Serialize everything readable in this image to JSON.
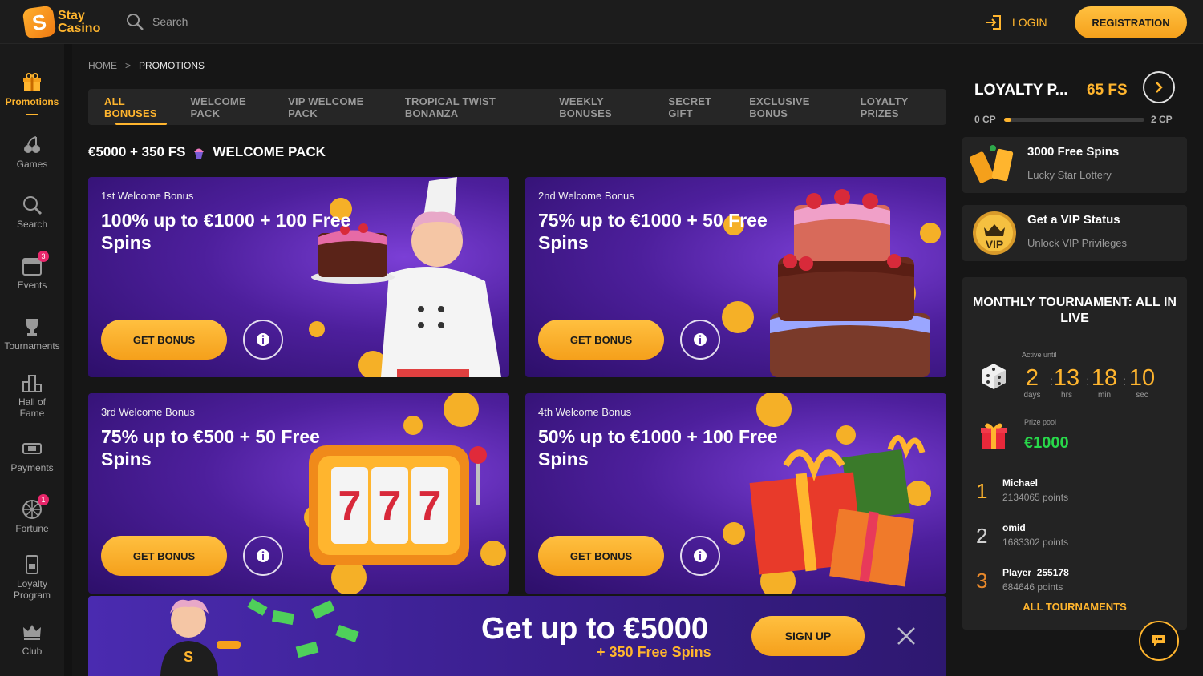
{
  "brand": {
    "name_line1": "Stay",
    "name_line2": "Casino",
    "accent": "#ffb52e"
  },
  "header": {
    "search_label": "Search",
    "login_label": "LOGIN",
    "registration_label": "REGISTRATION"
  },
  "sidebar": {
    "items": [
      {
        "label": "Promotions",
        "icon": "gift-icon",
        "active": true
      },
      {
        "label": "Games",
        "icon": "cherries-icon"
      },
      {
        "label": "Search",
        "icon": "search-icon"
      },
      {
        "label": "Events",
        "icon": "calendar-icon",
        "badge": "3"
      },
      {
        "label": "Tournaments",
        "icon": "trophy-icon"
      },
      {
        "label": "Hall of\nFame",
        "icon": "podium-icon"
      },
      {
        "label": "Payments",
        "icon": "card-icon"
      },
      {
        "label": "Fortune",
        "icon": "wheel-icon",
        "badge": "1"
      },
      {
        "label": "Loyalty\nProgram",
        "icon": "vip-card-icon"
      },
      {
        "label": "Club",
        "icon": "crown-icon"
      }
    ]
  },
  "breadcrumb": {
    "home": "HOME",
    "separator": ">",
    "current": "PROMOTIONS"
  },
  "tabs": [
    "ALL BONUSES",
    "WELCOME PACK",
    "VIP WELCOME PACK",
    "TROPICAL TWIST BONANZA",
    "WEEKLY BONUSES",
    "SECRET GIFT",
    "EXCLUSIVE BONUS",
    "LOYALTY PRIZES"
  ],
  "section": {
    "title_left": "€5000 + 350 FS",
    "title_right": "WELCOME PACK"
  },
  "cards": [
    {
      "kicker": "1st Welcome Bonus",
      "headline": "100% up to €1000 + 100 Free Spins",
      "button": "GET BONUS",
      "art": "chef-grandma-cake-art"
    },
    {
      "kicker": "2nd Welcome Bonus",
      "headline": "75% up to €1000 + 50 Free Spins",
      "button": "GET BONUS",
      "art": "layer-cake-art"
    },
    {
      "kicker": "3rd Welcome Bonus",
      "headline": "75% up to €500 + 50 Free Spins",
      "button": "GET BONUS",
      "art": "slot-machine-777-art"
    },
    {
      "kicker": "4th Welcome Bonus",
      "headline": "50% up to €1000 + 100 Free Spins",
      "button": "GET BONUS",
      "art": "gift-boxes-art"
    }
  ],
  "banner": {
    "headline": "Get up to €5000",
    "subline": "+ 350 Free Spins",
    "button": "SIGN UP"
  },
  "loyalty": {
    "title": "LOYALTY P...",
    "free_spins": "65 FS",
    "cp_min": "0 CP",
    "cp_max": "2 CP",
    "progress_fraction": 0.05
  },
  "promos": [
    {
      "title": "3000 Free Spins",
      "subtitle": "Lucky Star Lottery",
      "icon": "lottery-tickets-icon"
    },
    {
      "title": "Get a VIP Status",
      "subtitle": "Unlock VIP Privileges",
      "icon": "vip-crown-icon"
    }
  ],
  "tournament": {
    "title": "MONTHLY TOURNAMENT: ALL IN LIVE",
    "active_until_label": "Active until",
    "countdown": [
      {
        "value": "2",
        "unit": "days"
      },
      {
        "value": "13",
        "unit": "hrs"
      },
      {
        "value": "18",
        "unit": "min"
      },
      {
        "value": "10",
        "unit": "sec"
      }
    ],
    "prize_pool_label": "Prize pool",
    "prize_pool": "€1000",
    "leaders": [
      {
        "rank": "1",
        "name": "Michael",
        "points": "2134065 points"
      },
      {
        "rank": "2",
        "name": "omid",
        "points": "1683302 points"
      },
      {
        "rank": "3",
        "name": "Player_255178",
        "points": "684646 points"
      }
    ],
    "all_label": "ALL TOURNAMENTS"
  }
}
